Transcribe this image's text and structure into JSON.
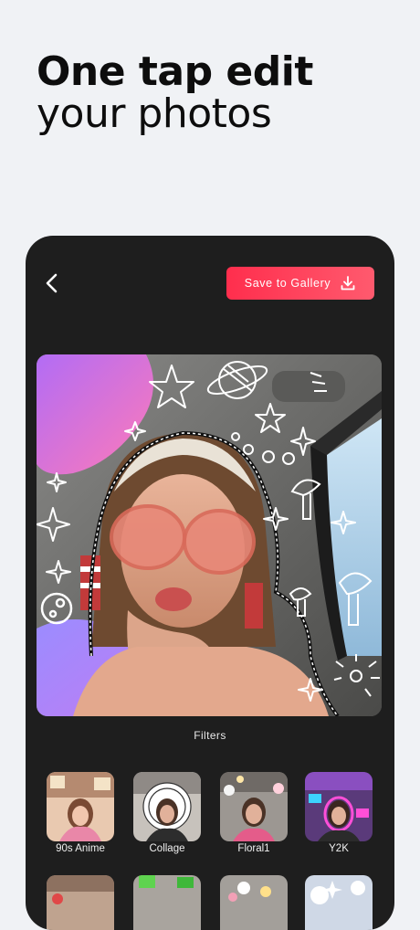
{
  "headline": {
    "line1": "One tap edit",
    "line2": "your photos"
  },
  "toolbar": {
    "back_icon": "chevron-left-icon",
    "save_label": "Save to Gallery",
    "save_icon": "download-icon"
  },
  "filters": {
    "title": "Filters",
    "items": [
      {
        "label": "90s Anime"
      },
      {
        "label": "Collage"
      },
      {
        "label": "Floral1"
      },
      {
        "label": "Y2K"
      }
    ]
  },
  "colors": {
    "accent": "#ff3b55",
    "panel": "#1e1e1e",
    "background": "#f0f2f5"
  }
}
